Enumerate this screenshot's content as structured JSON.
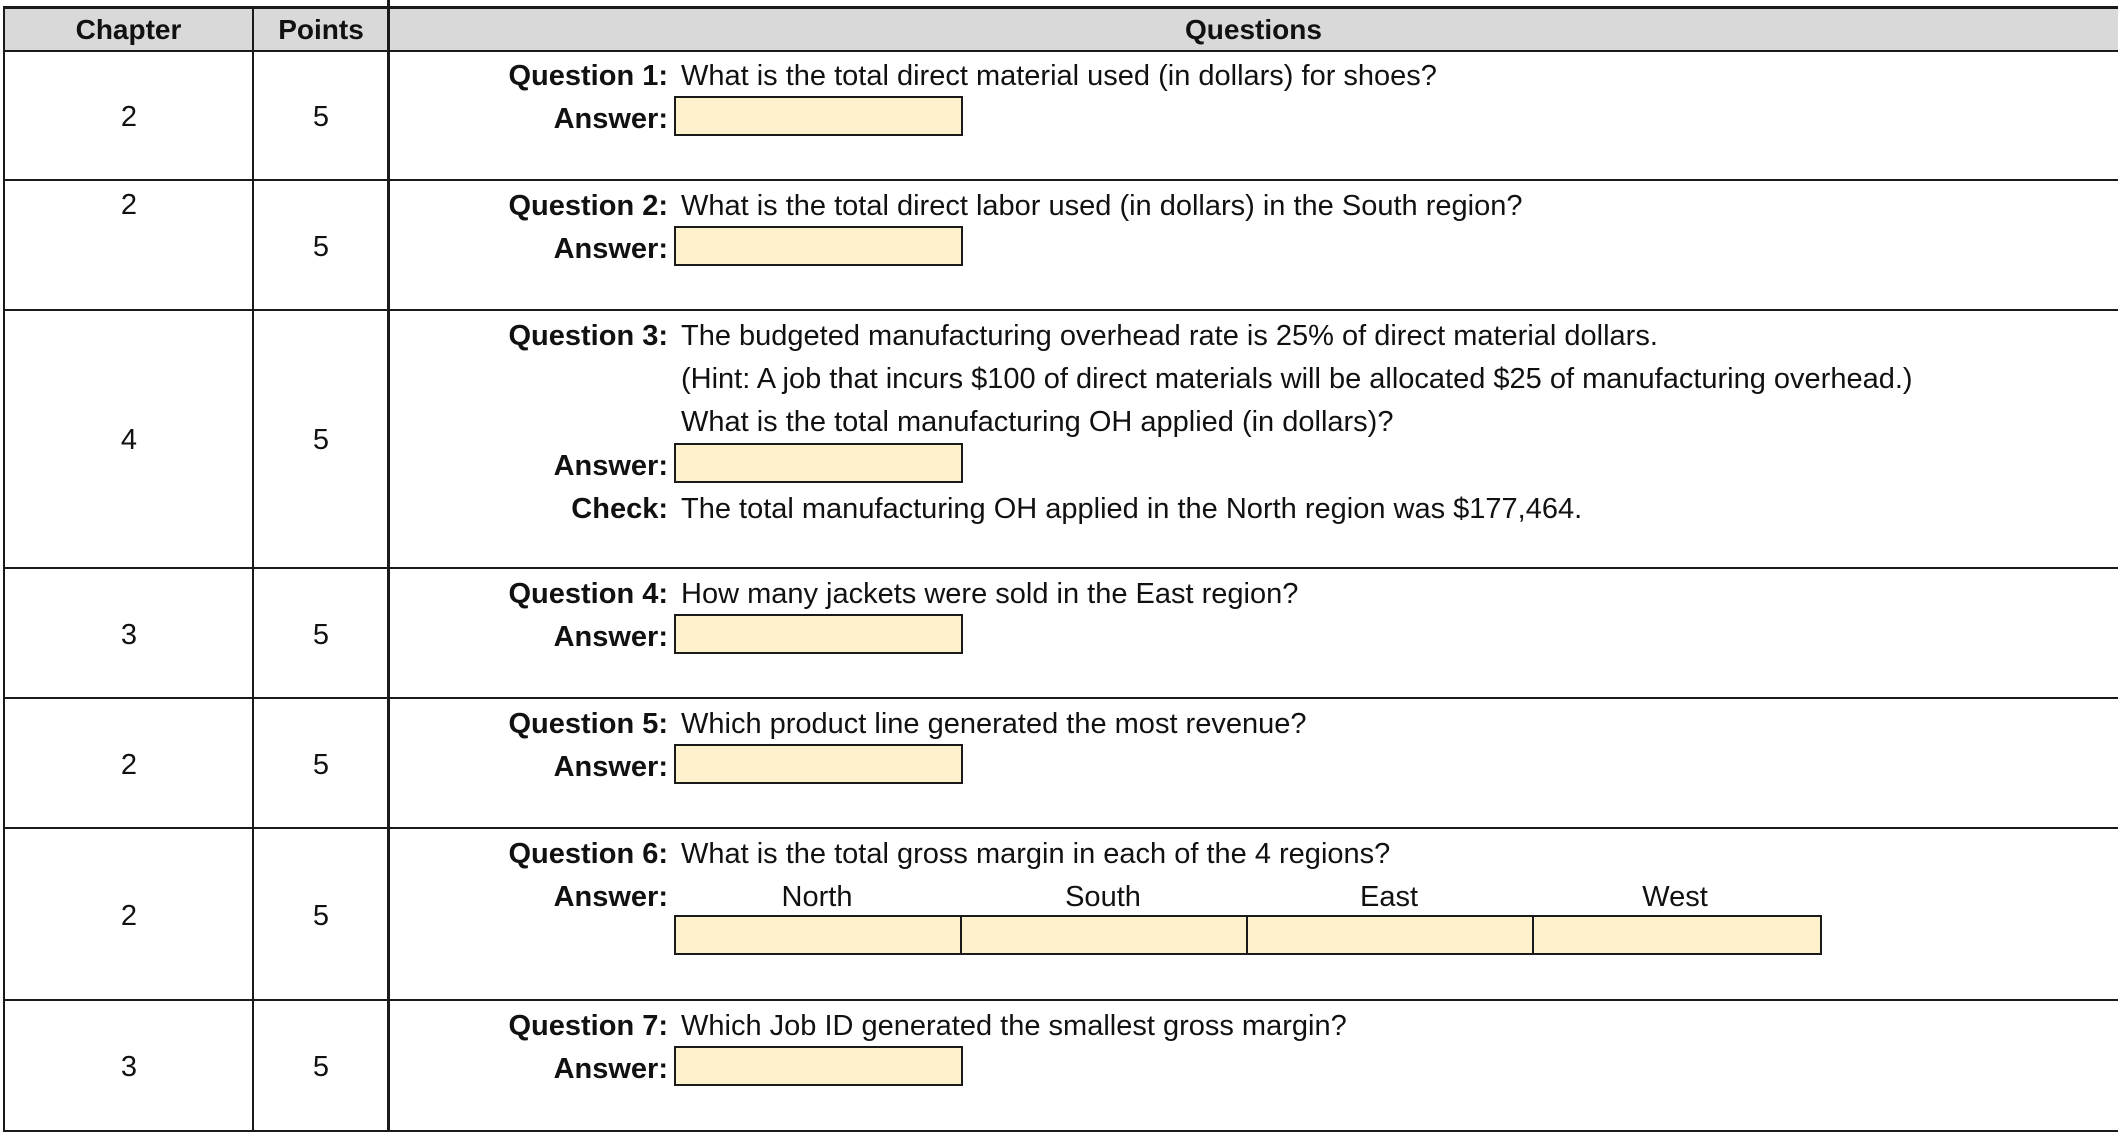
{
  "headers": {
    "chapter": "Chapter",
    "points": "Points",
    "questions": "Questions"
  },
  "rows": [
    {
      "chapter": "2",
      "points": "5",
      "label": "Question 1:",
      "lines": [
        "What is the total direct material used (in dollars) for shoes?"
      ],
      "answer_label": "Answer:"
    },
    {
      "chapter": "2",
      "points": "5",
      "label": "Question 2:",
      "lines": [
        "What is the total direct labor used (in dollars) in the South region?"
      ],
      "answer_label": "Answer:"
    },
    {
      "chapter": "4",
      "points": "5",
      "label": "Question 3:",
      "lines": [
        "The budgeted manufacturing overhead rate is 25% of direct material dollars.",
        "(Hint: A job that incurs $100 of direct materials will be allocated $25 of manufacturing overhead.)",
        "What is the total manufacturing OH applied (in dollars)?"
      ],
      "answer_label": "Answer:",
      "check_label": "Check:",
      "check_text": "The total manufacturing OH applied in the North region was $177,464."
    },
    {
      "chapter": "3",
      "points": "5",
      "label": "Question 4:",
      "lines": [
        "How many jackets were sold in the East region?"
      ],
      "answer_label": "Answer:"
    },
    {
      "chapter": "2",
      "points": "5",
      "label": "Question 5:",
      "lines": [
        "Which product line generated the most revenue?"
      ],
      "answer_label": "Answer:"
    },
    {
      "chapter": "2",
      "points": "5",
      "label": "Question 6:",
      "lines": [
        "What is the total gross margin in each of the 4 regions?"
      ],
      "answer_label": "Answer:",
      "regions": [
        "North",
        "South",
        "East",
        "West"
      ]
    },
    {
      "chapter": "3",
      "points": "5",
      "label": "Question 7:",
      "lines": [
        "Which Job ID generated the smallest gross margin?"
      ],
      "answer_label": "Answer:"
    }
  ],
  "colors": {
    "header_bg": "#d9d9d9",
    "answer_fill": "#fef2cd",
    "grid": "#1a1a1a"
  }
}
